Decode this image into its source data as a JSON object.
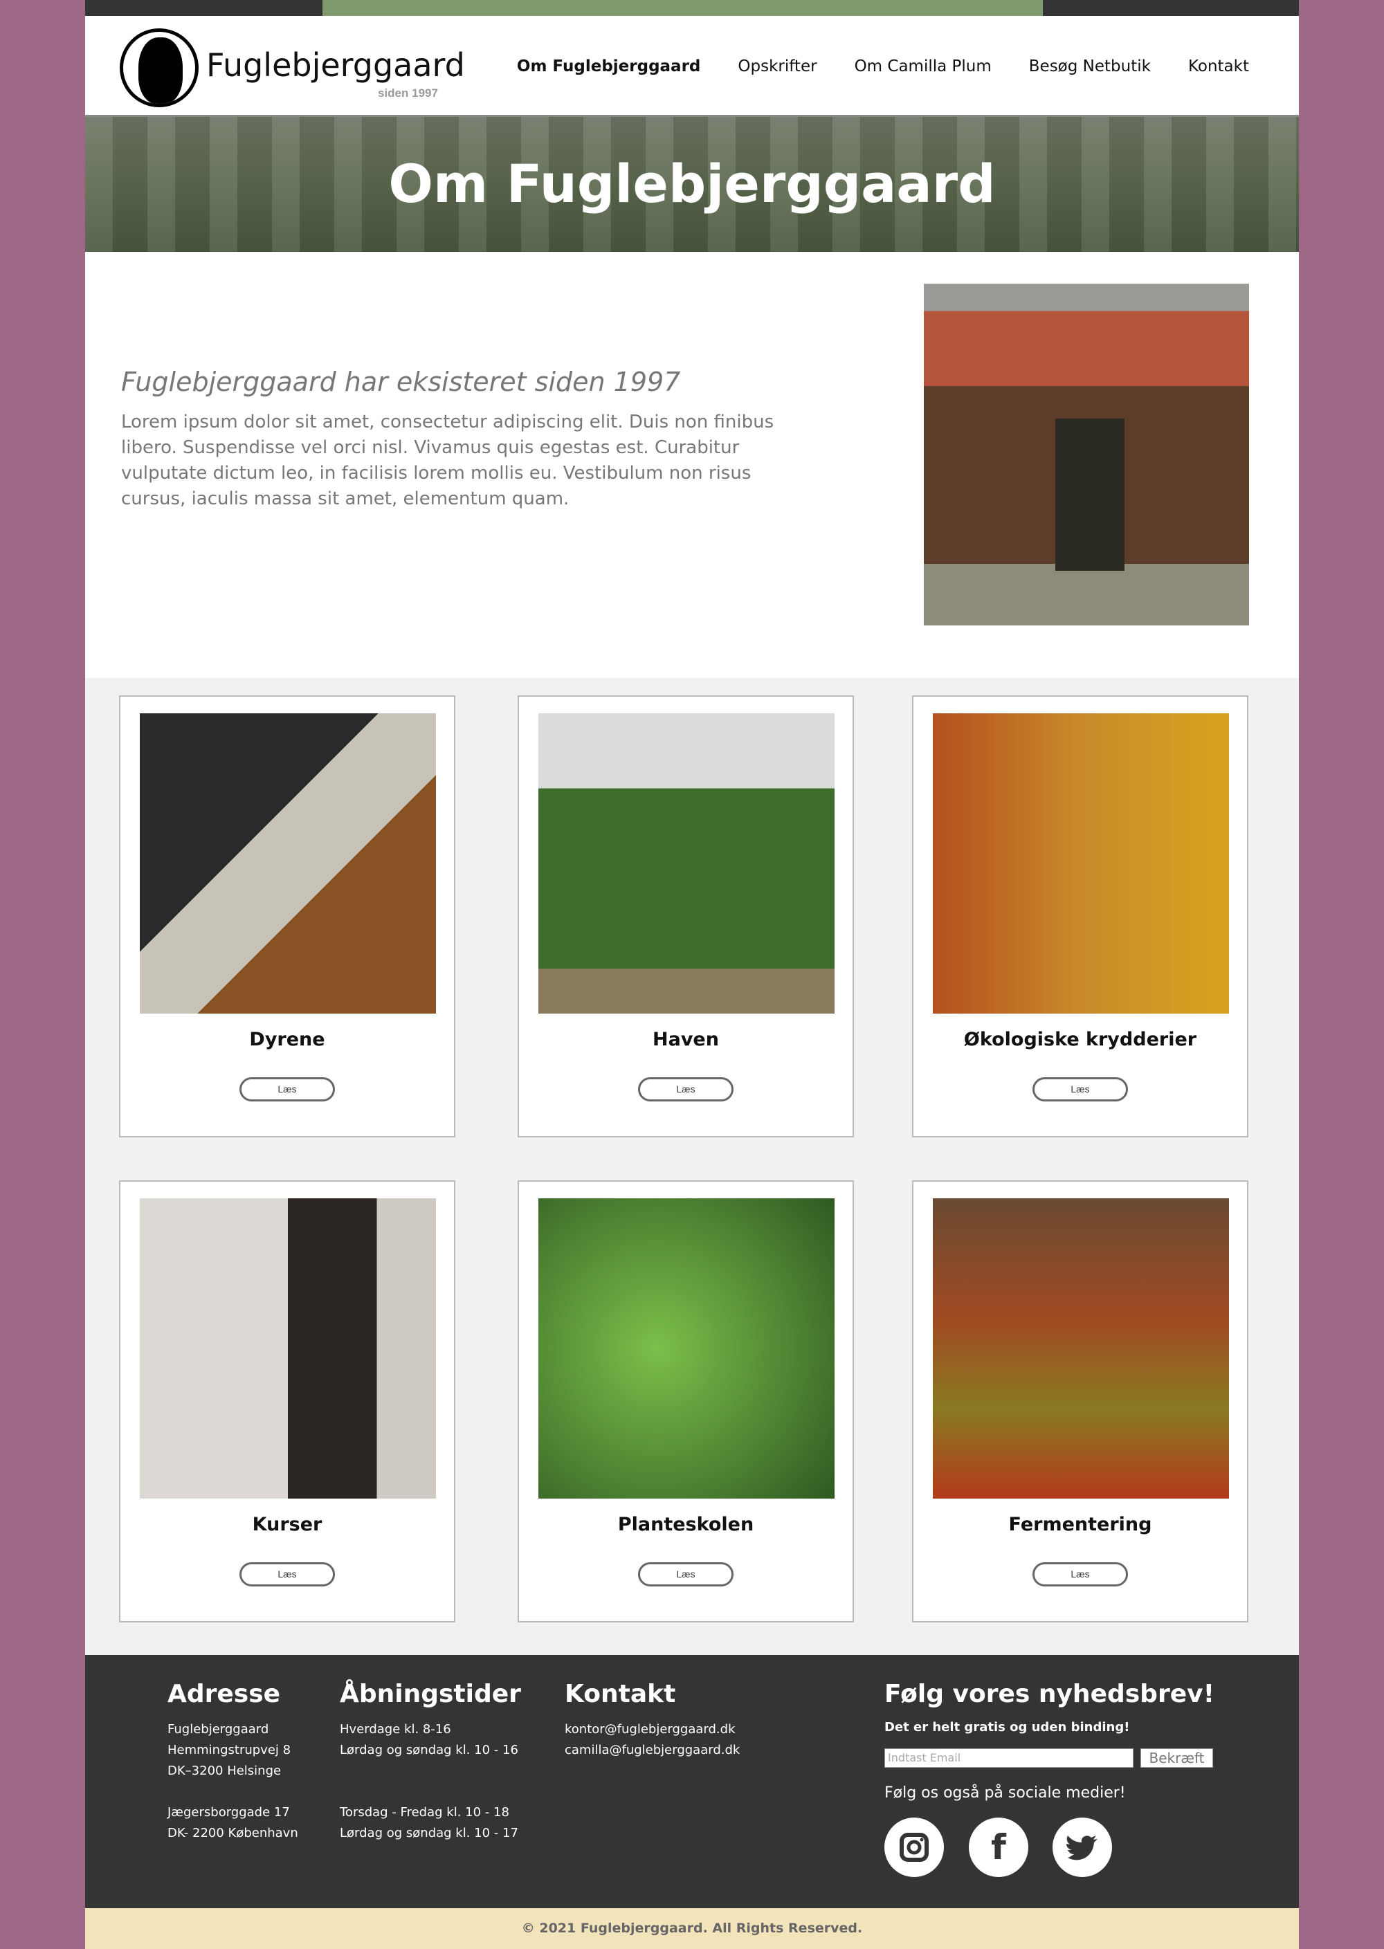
{
  "brand": {
    "name": "Fuglebjerggaard",
    "since": "siden 1997"
  },
  "nav": [
    {
      "label": "Om Fuglebjerggaard",
      "active": true
    },
    {
      "label": "Opskrifter"
    },
    {
      "label": "Om Camilla Plum"
    },
    {
      "label": "Besøg Netbutik"
    },
    {
      "label": "Kontakt"
    }
  ],
  "hero": {
    "title": "Om Fuglebjerggaard"
  },
  "intro": {
    "heading": "Fuglebjerggaard har eksisteret siden 1997",
    "text": "Lorem ipsum dolor sit amet, consectetur adipiscing elit. Duis non finibus libero. Suspendisse vel orci nisl. Vivamus quis egestas est. Curabitur vulputate dictum leo, in facilisis lorem mollis eu. Vestibulum non risus cursus, iaculis massa sit amet, elementum quam."
  },
  "cards": [
    {
      "title": "Dyrene",
      "button": "Læs"
    },
    {
      "title": "Haven",
      "button": "Læs"
    },
    {
      "title": "Økologiske krydderier",
      "button": "Læs"
    },
    {
      "title": "Kurser",
      "button": "Læs"
    },
    {
      "title": "Planteskolen",
      "button": "Læs"
    },
    {
      "title": "Fermentering",
      "button": "Læs"
    }
  ],
  "footer": {
    "address": {
      "heading": "Adresse",
      "lines": [
        "Fuglebjerggaard",
        "Hemmingstrupvej 8",
        "DK–3200 Helsinge",
        "",
        "Jægersborggade 17",
        "DK- 2200 København"
      ]
    },
    "hours": {
      "heading": "Åbningstider",
      "lines": [
        "Hverdage kl. 8-16",
        "Lørdag og søndag kl. 10 - 16",
        "",
        "",
        "Torsdag - Fredag kl. 10 - 18",
        "Lørdag og søndag kl. 10 - 17"
      ]
    },
    "contact": {
      "heading": "Kontakt",
      "lines": [
        "kontor@fuglebjerggaard.dk",
        "camilla@fuglebjerggaard.dk"
      ]
    },
    "newsletter": {
      "heading": "Følg vores nyhedsbrev!",
      "sub": "Det er helt gratis og uden binding!",
      "placeholder": "Indtast Email",
      "button": "Bekræft",
      "social_text": "Følg os også på sociale medier!"
    },
    "social": [
      "instagram-icon",
      "facebook-icon",
      "twitter-icon"
    ]
  },
  "copyright": "© 2021 Fuglebjerggaard. All Rights Reserved.",
  "colors": {
    "background": "#9c6886",
    "accent": "#7f9a6e",
    "footer": "#343434",
    "copyright_bar": "#f3e3bb"
  }
}
